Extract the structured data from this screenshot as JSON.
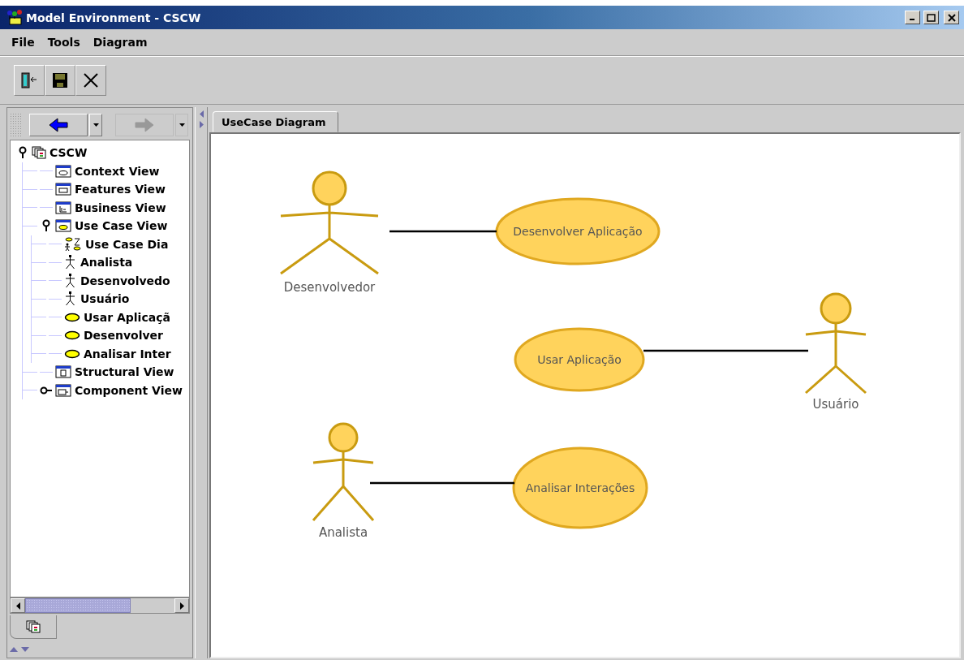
{
  "window": {
    "title": "Model Environment - CSCW"
  },
  "menu": [
    {
      "label": "File"
    },
    {
      "label": "Tools"
    },
    {
      "label": "Diagram"
    }
  ],
  "toolbar": [
    {
      "kind": "exit"
    },
    {
      "kind": "save"
    },
    {
      "kind": "close"
    }
  ],
  "navigator": {
    "back_disabled": false,
    "forward_disabled": true
  },
  "tree": [
    {
      "label": "CSCW",
      "kind": "root",
      "expanded": true,
      "children": [
        {
          "label": "Context View",
          "kind": "context-view"
        },
        {
          "label": "Features View",
          "kind": "features-view"
        },
        {
          "label": "Business View",
          "kind": "business-view"
        },
        {
          "label": "Use Case View",
          "kind": "usecase-view",
          "expanded": true,
          "children": [
            {
              "label": "Use Case Dia",
              "kind": "diagram"
            },
            {
              "label": "Analista",
              "kind": "actor"
            },
            {
              "label": "Desenvolvedo",
              "kind": "actor"
            },
            {
              "label": "Usuário",
              "kind": "actor"
            },
            {
              "label": "Usar Aplicaçã",
              "kind": "usecase"
            },
            {
              "label": "Desenvolver",
              "kind": "usecase"
            },
            {
              "label": "Analisar Inter",
              "kind": "usecase"
            }
          ]
        },
        {
          "label": "Structural View",
          "kind": "structural-view"
        },
        {
          "label": "Component View",
          "kind": "component-view",
          "expanded": false
        }
      ]
    }
  ],
  "tabs": [
    {
      "label": "UseCase Diagram",
      "selected": true
    }
  ],
  "diagram": {
    "actors": [
      {
        "name": "Desenvolvedor"
      },
      {
        "name": "Usuário"
      },
      {
        "name": "Analista"
      }
    ],
    "use_cases": [
      {
        "name": "Desenvolver Aplicação"
      },
      {
        "name": "Usar Aplicação"
      },
      {
        "name": "Analisar Interações"
      }
    ]
  }
}
